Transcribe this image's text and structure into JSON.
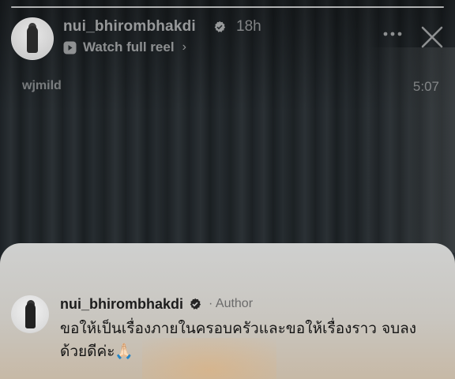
{
  "story": {
    "username": "nui_bhirombhakdi",
    "time_ago": "18h",
    "watch_label": "Watch full reel",
    "progress": 1.0
  },
  "video_overlay": {
    "handle": "wjmild",
    "timestamp": "5:07"
  },
  "comment": {
    "username": "nui_bhirombhakdi",
    "author_label": "· Author",
    "text": "ขอให้เป็นเรื่องภายในครอบครัวและขอให้เรื่องราว จบลงด้วยดีค่ะ🙏🏻"
  },
  "icons": {
    "verified": "verified-badge-icon",
    "reel": "reel-icon",
    "more": "more-options-icon",
    "close": "close-icon",
    "chevron": "chevron-right-icon"
  },
  "colors": {
    "verified_fill": "#ffffff",
    "sheet_bg": "#cfd0cf"
  }
}
